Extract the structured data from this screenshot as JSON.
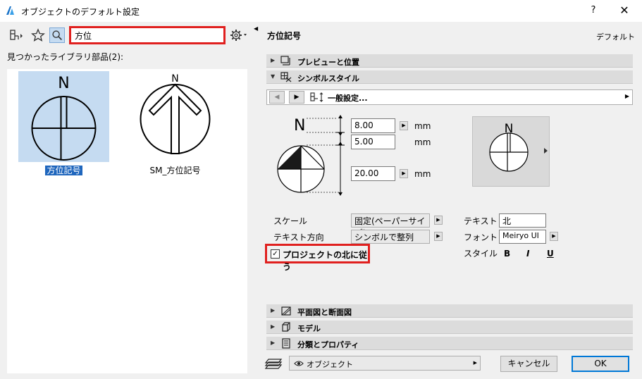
{
  "window": {
    "title": "オブジェクトのデフォルト設定",
    "help": "?",
    "close": "✕"
  },
  "search": {
    "value": "方位"
  },
  "library": {
    "found_label": "見つかったライブラリ部品(2):",
    "items": [
      {
        "label": "方位記号",
        "selected": true
      },
      {
        "label": "SM_方位記号",
        "selected": false
      }
    ]
  },
  "object": {
    "title": "方位記号",
    "default_label": "デフォルト"
  },
  "sections": {
    "preview": "プレビューと位置",
    "symbol_style": "シンボルスタイル",
    "plan_section": "平面図と断面図",
    "model": "モデル",
    "classification": "分類とプロパティ"
  },
  "nav": {
    "label": "一般設定..."
  },
  "dimensions": {
    "north_letter": "N",
    "values": [
      "8.00",
      "5.00",
      "20.00"
    ],
    "unit": "mm"
  },
  "preview_letter": "N",
  "settings": {
    "scale_label": "スケール",
    "scale_value": "固定(ペーパーサイズ)",
    "text_dir_label": "テキスト方向",
    "text_dir_value": "シンボルで整列",
    "follow_north_label": "プロジェクトの北に従う",
    "text_label": "テキスト",
    "text_value": "北",
    "font_label": "フォント",
    "font_value": "Meiryo UI",
    "style_label": "スタイル",
    "style_bold": "B",
    "style_italic": "I",
    "style_underline": "U"
  },
  "footer": {
    "layer": "オブジェクト",
    "cancel": "キャンセル",
    "ok": "OK"
  }
}
